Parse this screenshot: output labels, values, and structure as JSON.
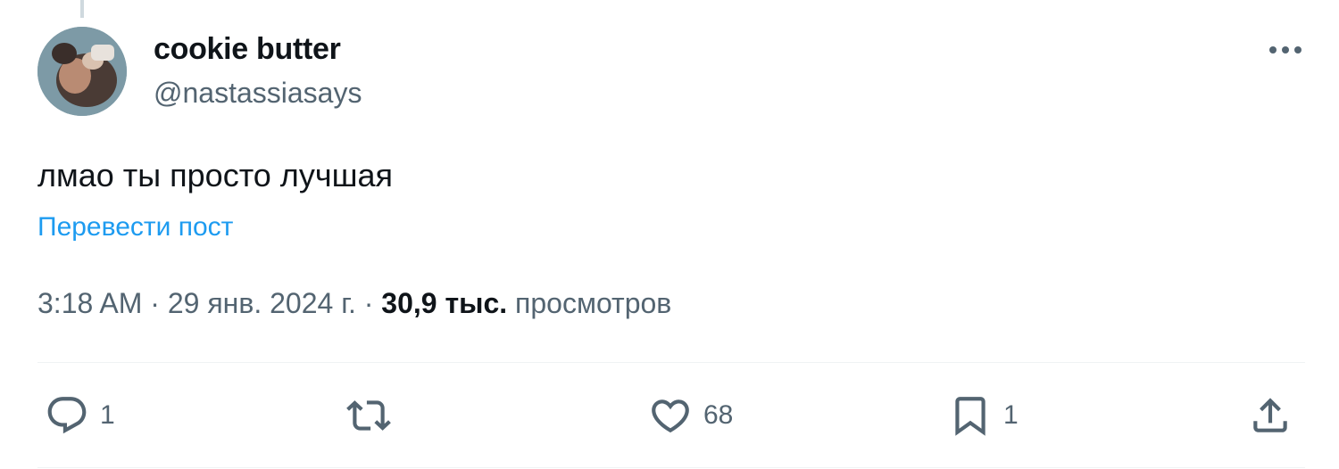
{
  "tweet": {
    "author": {
      "display_name": "cookie butter",
      "handle": "@nastassiasays"
    },
    "text": "лмао ты просто лучшая",
    "translate_label": "Перевести пост",
    "time": "3:18 AM",
    "separator": "·",
    "date": "29 янв. 2024 г.",
    "views_count": "30,9 тыс.",
    "views_label": "просмотров"
  },
  "actions": {
    "replies": "1",
    "reposts": "",
    "likes": "68",
    "bookmarks": "1"
  },
  "icons": {
    "more": "more-horizontal-icon",
    "reply": "reply-icon",
    "repost": "repost-icon",
    "like": "heart-icon",
    "bookmark": "bookmark-icon",
    "share": "share-icon"
  },
  "colors": {
    "link": "#1d9bf0",
    "secondary_text": "#536471",
    "primary_text": "#0f1419"
  }
}
